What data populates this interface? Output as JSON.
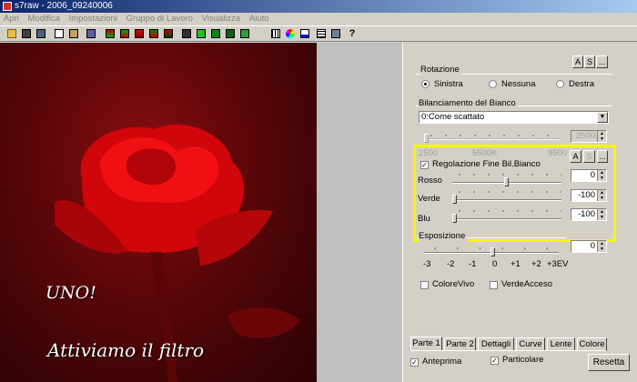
{
  "window": {
    "title": "s7raw - 2006_09240006"
  },
  "menu": [
    "Apri",
    "Modifica",
    "Impostazioni",
    "Gruppo di Lavoro",
    "Visualizza",
    "Aiuto"
  ],
  "toolbar": {
    "icons": [
      "open-icon",
      "save-icon",
      "save-as-icon",
      "copy-icon",
      "paste-icon",
      "cube-icon",
      "filter-icon",
      "filter-icon",
      "filter-icon",
      "filter-icon",
      "filter-icon",
      "paint-icon",
      "green-square-icon",
      "green-square-icon",
      "green-square-icon",
      "green-square-icon",
      "grid-icon",
      "palette-icon",
      "histogram-icon",
      "grid-icon",
      "brush-icon",
      "help-icon"
    ],
    "help_label": "?"
  },
  "photo": {
    "caption_1": "UNO!",
    "caption_2": "Attiviamo il filtro"
  },
  "panel": {
    "top_buttons": {
      "a": "A",
      "s": "S",
      "more": "..."
    },
    "rotation": {
      "title": "Rotazione",
      "options": [
        "Sinistra",
        "Nessuna",
        "Destra"
      ],
      "selected": "Sinistra"
    },
    "white_balance": {
      "title": "Bilanciamento del Bianco",
      "mode": "0:Come scattato",
      "temperature": "2500",
      "scale": [
        "2500",
        "5500K",
        "9500"
      ]
    },
    "fine_wb": {
      "label": "Regolazione Fine Bil.Bianco",
      "checked": true,
      "buttons": {
        "a": "A",
        "s": "S",
        "more": "..."
      },
      "rows": [
        {
          "label": "Rosso",
          "value": "0",
          "level": 0.5
        },
        {
          "label": "Verde",
          "value": "-100",
          "level": 0
        },
        {
          "label": "Blu",
          "value": "-100",
          "level": 0
        }
      ]
    },
    "exposure": {
      "title": "Esposizione",
      "value": "0",
      "scale": [
        "-3",
        "-2",
        "-1",
        "0",
        "+1",
        "+2",
        "+3EV"
      ]
    },
    "checks": [
      {
        "label": "ColoreVivo",
        "checked": false
      },
      {
        "label": "VerdeAcceso",
        "checked": false
      }
    ],
    "tabs": [
      "Parte 1",
      "Parte 2",
      "Dettagli",
      "Curve",
      "Lente",
      "Colore"
    ],
    "active_tab": "Parte 1",
    "bottom": {
      "preview": {
        "label": "Anteprima",
        "checked": true
      },
      "detail": {
        "label": "Particolare",
        "checked": true
      },
      "reset": "Resetta"
    }
  },
  "colors": {
    "highlight": "#f7f700",
    "title_bar": "#0a246a"
  }
}
